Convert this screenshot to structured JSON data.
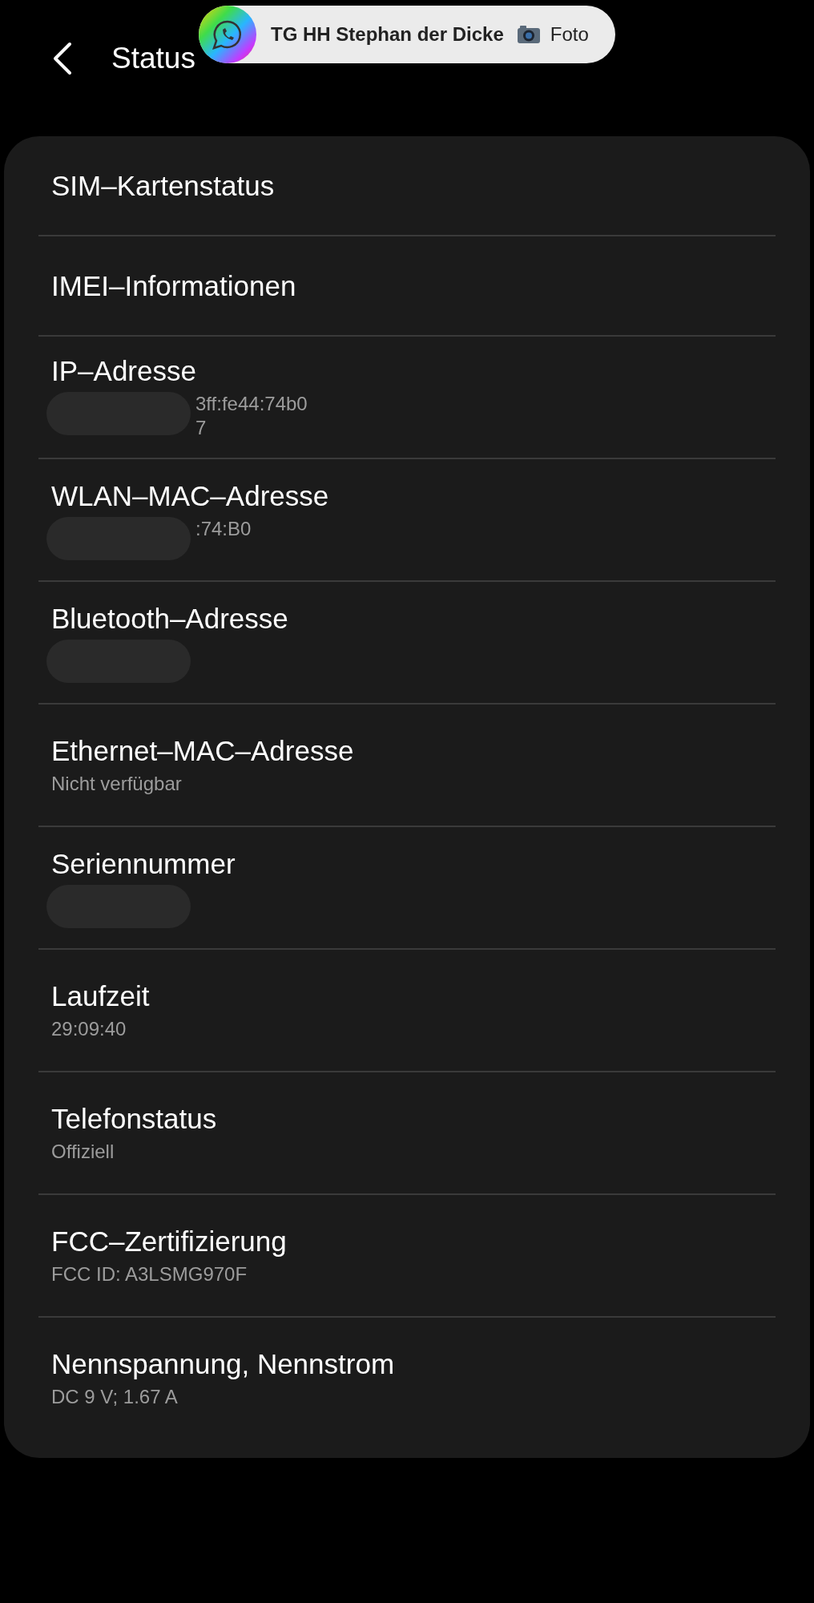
{
  "header": {
    "title": "Status"
  },
  "notification": {
    "title": "TG HH Stephan der Dicke",
    "text": "Foto"
  },
  "items": [
    {
      "title": "SIM–Kartenstatus",
      "redacted": false
    },
    {
      "title": "IMEI–Informationen",
      "redacted": false
    },
    {
      "title": "IP–Adresse",
      "values": [
        "3ff:fe44:74b0",
        "7"
      ],
      "redacted": true
    },
    {
      "title": "WLAN–MAC–Adresse",
      "values": [
        ":74:B0"
      ],
      "redacted": true
    },
    {
      "title": "Bluetooth–Adresse",
      "redacted": true
    },
    {
      "title": "Ethernet–MAC–Adresse",
      "values": [
        "Nicht verfügbar"
      ],
      "redacted": false
    },
    {
      "title": "Seriennummer",
      "redacted": true
    },
    {
      "title": "Laufzeit",
      "values": [
        "29:09:40"
      ],
      "redacted": false
    },
    {
      "title": "Telefonstatus",
      "values": [
        "Offiziell"
      ],
      "redacted": false
    },
    {
      "title": "FCC–Zertifizierung",
      "values": [
        "FCC ID: A3LSMG970F"
      ],
      "redacted": false
    },
    {
      "title": "Nennspannung, Nennstrom",
      "values": [
        "DC 9 V; 1.67 A"
      ],
      "redacted": false
    }
  ]
}
